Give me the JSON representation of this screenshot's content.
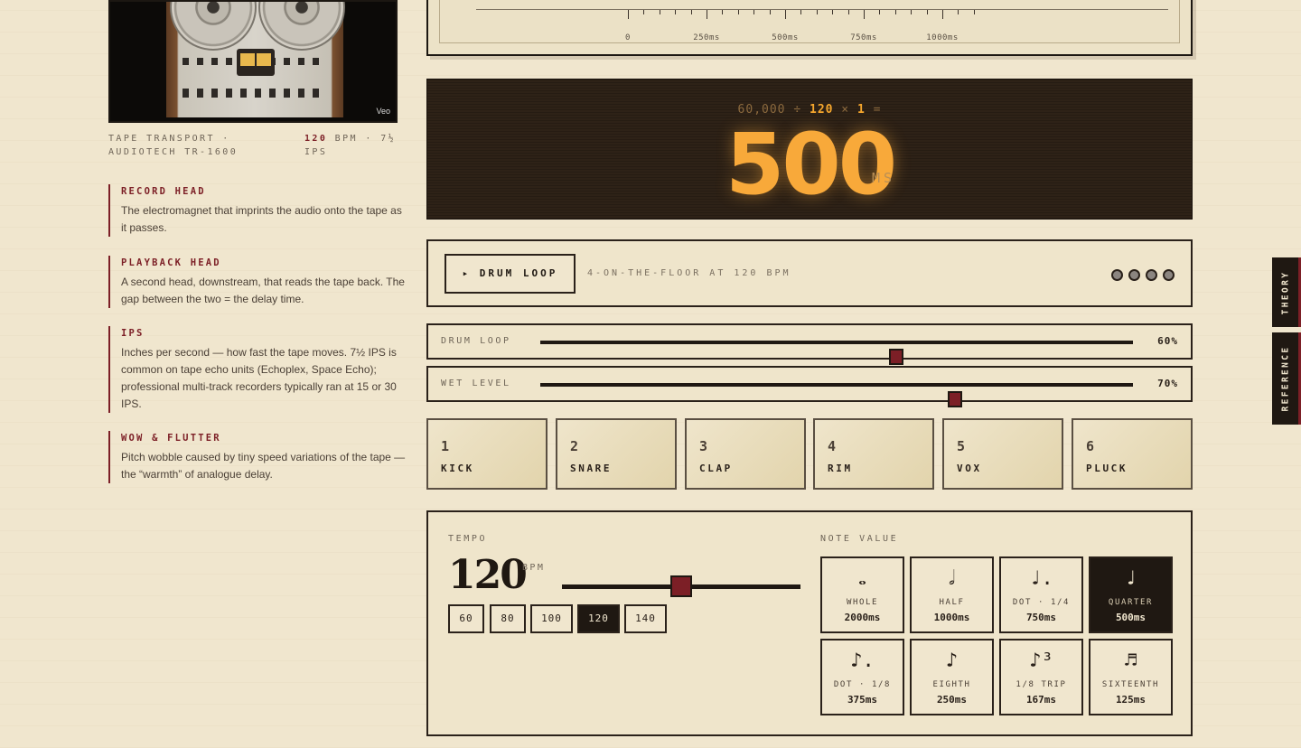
{
  "photo": {
    "watermark": "Veo"
  },
  "caption": {
    "left": "TAPE TRANSPORT · AUDIOTECH TR-1600",
    "bpm_value": "120",
    "right_rest": " BPM · 7½ IPS"
  },
  "glossary": [
    {
      "term": "RECORD HEAD",
      "def": "The electromagnet that imprints the audio onto the tape as it passes."
    },
    {
      "term": "PLAYBACK HEAD",
      "def": "A second head, downstream, that reads the tape back. The gap between the two = the delay time."
    },
    {
      "term": "IPS",
      "def": "Inches per second — how fast the tape moves. 7½ IPS is common on tape echo units (Echoplex, Space Echo); professional multi-track recorders typically ran at 15 or 30 IPS."
    },
    {
      "term": "WOW & FLUTTER",
      "def": "Pitch wobble caused by tiny speed variations of the tape — the “warmth” of analogue delay."
    }
  ],
  "scale": {
    "labels": [
      "0",
      "250ms",
      "500ms",
      "750ms",
      "1000ms"
    ]
  },
  "display": {
    "f_const": "60,000 ÷ ",
    "f_bpm": "120",
    "f_times": " × ",
    "f_mult": "1",
    "f_eq": " =",
    "value": "500",
    "unit": "MS"
  },
  "loop": {
    "button": "▸ DRUM LOOP",
    "desc": "4-ON-THE-FLOOR AT 120 BPM"
  },
  "sliders": [
    {
      "label": "DRUM LOOP",
      "value": "60%",
      "fraction": 0.6
    },
    {
      "label": "WET LEVEL",
      "value": "70%",
      "fraction": 0.7
    }
  ],
  "pads": [
    {
      "num": "1",
      "name": "KICK"
    },
    {
      "num": "2",
      "name": "SNARE"
    },
    {
      "num": "3",
      "name": "CLAP"
    },
    {
      "num": "4",
      "name": "RIM"
    },
    {
      "num": "5",
      "name": "VOX"
    },
    {
      "num": "6",
      "name": "PLUCK"
    }
  ],
  "tempo": {
    "label": "TEMPO",
    "bpm": "120",
    "unit": "BPM",
    "presets": [
      "60",
      "80",
      "100",
      "120",
      "140"
    ],
    "active_preset": "120"
  },
  "note_value": {
    "label": "NOTE VALUE",
    "notes": [
      {
        "glyph": "𝅝",
        "name": "WHOLE",
        "ms": "2000ms"
      },
      {
        "glyph": "𝅗𝅥",
        "name": "HALF",
        "ms": "1000ms"
      },
      {
        "glyph": "♩.",
        "name": "DOT · 1/4",
        "ms": "750ms"
      },
      {
        "glyph": "♩",
        "name": "QUARTER",
        "ms": "500ms",
        "active": true
      },
      {
        "glyph": "♪.",
        "name": "DOT · 1/8",
        "ms": "375ms"
      },
      {
        "glyph": "♪",
        "name": "EIGHTH",
        "ms": "250ms"
      },
      {
        "glyph": "♪³",
        "name": "1/8 TRIP",
        "ms": "167ms"
      },
      {
        "glyph": "♬",
        "name": "SIXTEENTH",
        "ms": "125ms"
      }
    ]
  },
  "side_tabs": [
    "THEORY",
    "REFERENCE"
  ],
  "colors": {
    "accent": "#7c1f26",
    "amber": "#f8a93a",
    "ink": "#1f1812",
    "paper": "#f0e6ce"
  }
}
